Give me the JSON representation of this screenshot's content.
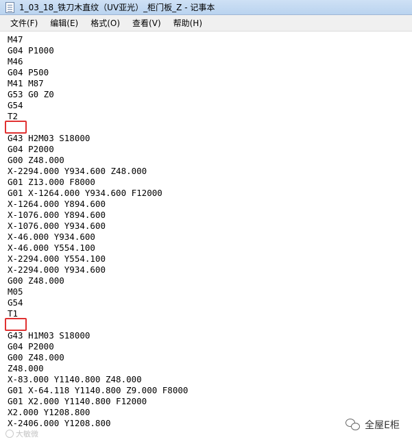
{
  "window": {
    "title": "1_03_18_铁刀木直纹（UV亚光）_柜门板_Z - 记事本"
  },
  "menubar": {
    "items": [
      {
        "label": "文件(F)"
      },
      {
        "label": "编辑(E)"
      },
      {
        "label": "格式(O)"
      },
      {
        "label": "查看(V)"
      },
      {
        "label": "帮助(H)"
      }
    ]
  },
  "editor": {
    "lines": [
      "M47",
      "G04 P1000",
      "M46",
      "G04 P500",
      "M41 M87",
      "G53 G0 Z0",
      "G54",
      "T2",
      "M03 S18000",
      "G43 H2",
      "G04 P2000",
      "G00 Z48.000",
      "X-2294.000 Y934.600 Z48.000",
      "G01 Z13.000 F8000",
      "G01 X-1264.000 Y934.600 F12000",
      "X-1264.000 Y894.600",
      "X-1076.000 Y894.600",
      "X-1076.000 Y934.600",
      "X-46.000 Y934.600",
      "X-46.000 Y554.100",
      "X-2294.000 Y554.100",
      "X-2294.000 Y934.600",
      "G00 Z48.000",
      "M05",
      "G54",
      "T1",
      "M03 S18000",
      "G43 H1",
      "G04 P2000",
      "G00 Z48.000",
      "Z48.000",
      "X-83.000 Y1140.800 Z48.000",
      "G01 X-64.118 Y1140.800 Z9.000 F8000",
      "G01 X2.000 Y1140.800 F12000",
      "X2.000 Y1208.800",
      "X-2406.000 Y1208.800"
    ],
    "highlight_color": "#e03030"
  },
  "watermarks": {
    "left_text": "大敏微",
    "right_text": "全屋E柜"
  }
}
